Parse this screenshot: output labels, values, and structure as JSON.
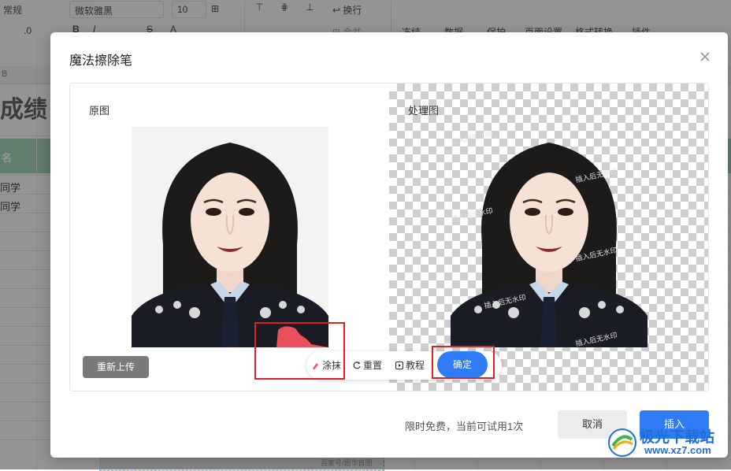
{
  "app": {
    "toolbar": {
      "font_style": "常规",
      "font_name": "微软雅黑",
      "font_size": "10",
      "decimal_value": ".0",
      "wrap_label": "换行",
      "merge_label": "合并",
      "freeze_label": "冻结",
      "data_label": "数据",
      "protect_label": "保护",
      "page_setup_label": "页面设置",
      "format_convert_label": "格式转换",
      "plugin_label": "插件"
    },
    "sheet": {
      "column_b": "B",
      "title_fragment": "成绩",
      "header_fragment": "名",
      "rows": [
        "同学",
        "同学"
      ],
      "bottom_watermark": "百家号/题华首图"
    }
  },
  "dialog": {
    "title": "魔法擦除笔",
    "original_label": "原图",
    "processed_label": "处理图",
    "watermark_text": "插入后无水印",
    "reupload_button": "重新上传",
    "tools": {
      "smear": "涂抹",
      "reset": "重置",
      "tutorial": "教程"
    },
    "confirm_button": "确定",
    "footer_note": "限时免费，当前可试用1次",
    "cancel_button": "取消",
    "insert_button": "插入"
  },
  "site_logo": {
    "name": "极光下载站",
    "url_text": "www.xz7.com"
  },
  "colors": {
    "primary": "#2f7cf6",
    "highlight": "#e02020",
    "smear_mark": "#e8505b",
    "header_green": "#a8d8b9"
  }
}
